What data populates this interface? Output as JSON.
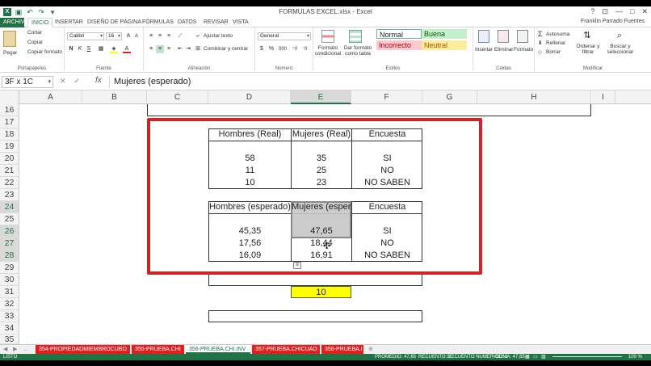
{
  "window": {
    "title": "FORMULAS EXCEL.xlsx - Excel",
    "controls": [
      "?",
      "⊡",
      "—",
      "□",
      "✕"
    ]
  },
  "tabs": [
    {
      "label": "ARCHIVO"
    },
    {
      "label": "INICIO"
    },
    {
      "label": "INSERTAR"
    },
    {
      "label": "DISEÑO DE PÁGINA"
    },
    {
      "label": "FÓRMULAS"
    },
    {
      "label": "DATOS"
    },
    {
      "label": "REVISAR"
    },
    {
      "label": "VISTA"
    }
  ],
  "user": "Franklin Parrado Fuentes",
  "ribbon": {
    "clipboard": {
      "paste": "Pegar",
      "cut": "Cortar",
      "copy": "Copiar",
      "format_painter": "Copiar formato",
      "label": "Portapapeles"
    },
    "font": {
      "name": "Calibri",
      "size": "16",
      "bold": "N",
      "italic": "K",
      "underline": "S",
      "label": "Fuente"
    },
    "alignment": {
      "wrap": "Ajustar texto",
      "merge": "Combinar y centrar",
      "label": "Alineación"
    },
    "number": {
      "format": "General",
      "currency": "$",
      "percent": "%",
      "thousands": "000",
      "label": "Número"
    },
    "styles": {
      "cond_format": "Formato condicional",
      "as_table": "Dar formato como tabla",
      "normal": "Normal",
      "good": "Buena",
      "bad": "Incorrecto",
      "neutral": "Neutral",
      "label": "Estilos"
    },
    "cells": {
      "insert": "Insertar",
      "delete": "Eliminar",
      "format": "Formato",
      "label": "Celdas"
    },
    "editing": {
      "autosum": "Autosuma",
      "fill": "Rellenar",
      "clear": "Borrar",
      "sort": "Ordenar y filtrar",
      "find": "Buscar y seleccionar",
      "label": "Modificar"
    }
  },
  "formula_bar": {
    "name_box": "3F x 1C",
    "cancel": "✕",
    "enter": "✓",
    "fx": "fx",
    "content": "Mujeres (esperado)"
  },
  "columns": [
    "A",
    "B",
    "C",
    "D",
    "E",
    "F",
    "G",
    "H",
    "I"
  ],
  "rows": [
    "16",
    "17",
    "18",
    "19",
    "20",
    "21",
    "22",
    "23",
    "24",
    "25",
    "26",
    "27",
    "28",
    "29",
    "30",
    "31",
    "32",
    "33",
    "34",
    "35"
  ],
  "table_real": {
    "headers": [
      "Hombres (Real)",
      "Mujeres (Real)",
      "Encuesta"
    ],
    "rows": [
      [
        "58",
        "35",
        "SI"
      ],
      [
        "11",
        "25",
        "NO"
      ],
      [
        "10",
        "23",
        "NO SABEN"
      ]
    ]
  },
  "table_expected": {
    "headers": [
      "Hombres (esperado)",
      "Mujeres (esperado)",
      "Encuesta"
    ],
    "rows": [
      [
        "45,35",
        "47,65",
        "SI"
      ],
      [
        "17,56",
        "18,44",
        "NO"
      ],
      [
        "16,09",
        "16,91",
        "NO SABEN"
      ]
    ]
  },
  "highlight_cell": {
    "value": "10",
    "color": "#ffff00"
  },
  "accent_colors": {
    "excel_green": "#217346",
    "annotation_red": "#d0242a",
    "sheet_tab_red": "#e02020"
  },
  "sheet_tabs": [
    {
      "label": "354-PROPIEDADMIEMBROCUBO",
      "active": false
    },
    {
      "label": "355-PRUEBA.CHI",
      "active": false
    },
    {
      "label": "356-PRUEBA.CHI.INV",
      "active": true
    },
    {
      "label": "357-PRUEBA.CHICUAD",
      "active": false
    },
    {
      "label": "358-PRUEBA.I",
      "active": false
    }
  ],
  "status": {
    "mode": "LISTO",
    "average": "PROMEDIO: 47,65",
    "count": "RECUENTO: 2",
    "numeric_count": "RECUENTO NUMÉRICO: 1",
    "sum": "SUMA: 47,65",
    "zoom": "100 %"
  }
}
